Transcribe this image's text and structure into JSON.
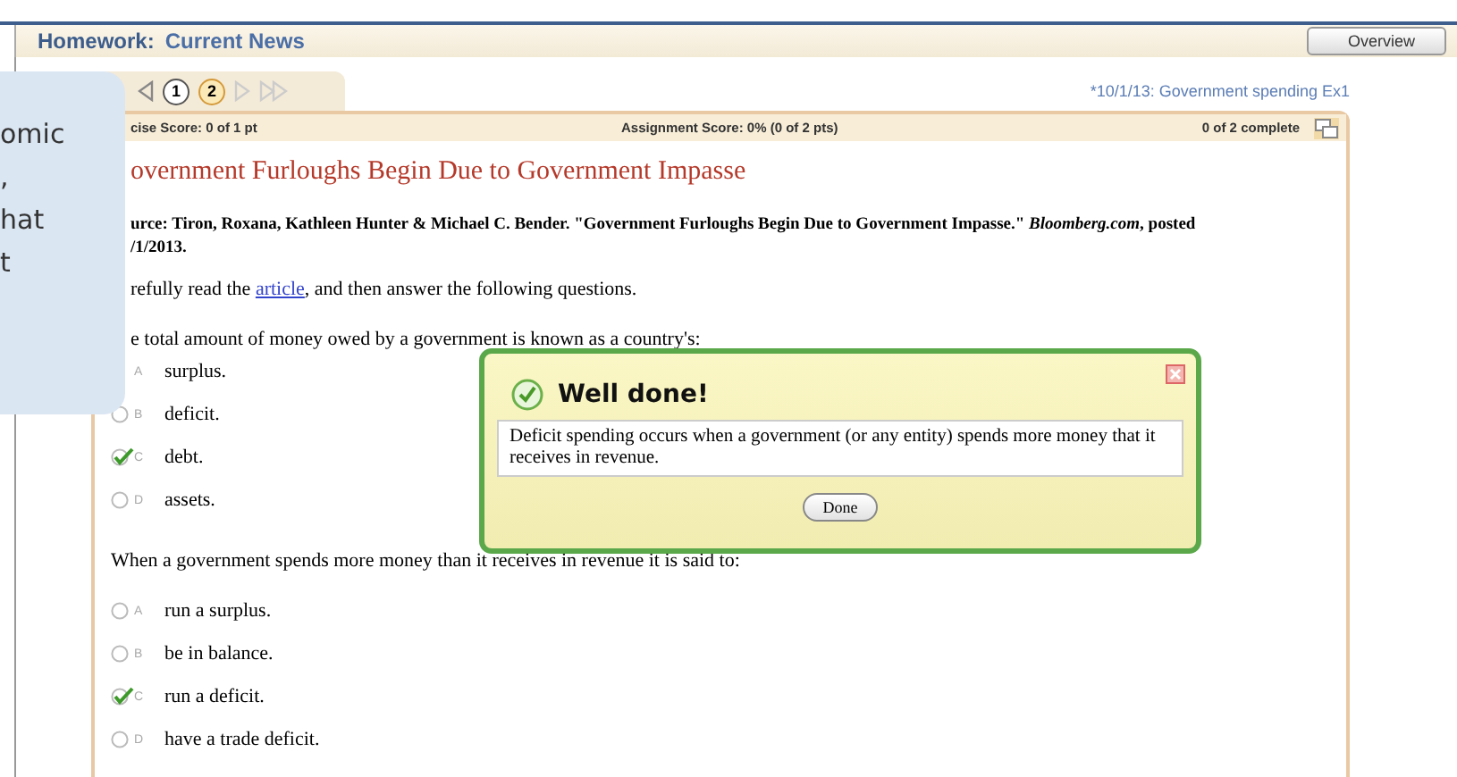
{
  "header": {
    "label": "Homework:",
    "title": "Current News",
    "button": "Overview"
  },
  "nav": {
    "pages": [
      {
        "label": "1",
        "selected": false
      },
      {
        "label": "2",
        "selected": true
      }
    ],
    "assignment": "*10/1/13: Government spending Ex1"
  },
  "score_bar": {
    "exercise": "cise Score: 0 of 1 pt",
    "assignment": "Assignment Score: 0% (0 of 2 pts)",
    "complete": "0 of 2 complete"
  },
  "title": "overnment Furloughs Begin Due to Government Impasse",
  "source_lines": [
    "urce: Tiron, Roxana, Kathleen Hunter & Michael C. Bender. \"Government Furloughs Begin Due to Government Impasse.\" *Bloomberg.com*, posted",
    "/1/2013."
  ],
  "instruction": {
    "before": "refully read the",
    "link": "article",
    "after": ", and then answer the following questions."
  },
  "questions": [
    {
      "text": "e total amount of money owed by a government is known as a country's:",
      "options": [
        {
          "kind": "letter_only",
          "letter": "A",
          "text": "surplus."
        },
        {
          "kind": "radio",
          "letter": "B",
          "text": "deficit.",
          "checked": false
        },
        {
          "kind": "radio",
          "letter": "C",
          "text": "debt.",
          "checked": true
        },
        {
          "kind": "radio",
          "letter": "D",
          "text": "assets.",
          "checked": false
        }
      ]
    },
    {
      "text": "When a government spends more money than it receives in revenue it is said to:",
      "options": [
        {
          "kind": "radio",
          "letter": "A",
          "text": "run a surplus.",
          "checked": false
        },
        {
          "kind": "radio",
          "letter": "B",
          "text": "be in balance.",
          "checked": false
        },
        {
          "kind": "radio",
          "letter": "C",
          "text": "run a deficit.",
          "checked": true
        },
        {
          "kind": "radio",
          "letter": "D",
          "text": "have a trade deficit.",
          "checked": false
        }
      ]
    }
  ],
  "feedback": {
    "title": "Well done!",
    "message": "Deficit spending occurs when a government (or any entity) spends more money that it receives in revenue.",
    "button": "Done"
  },
  "callout": {
    "lines": [
      "omic",
      ",",
      "hat",
      "t"
    ]
  }
}
